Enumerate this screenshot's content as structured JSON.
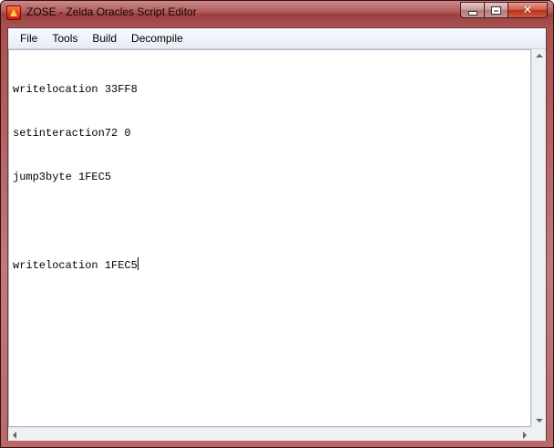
{
  "window": {
    "title": "ZOSE - Zelda Oracles Script Editor",
    "icon": "app-icon",
    "controls": {
      "minimize_icon": "minimize-icon",
      "maximize_icon": "maximize-icon",
      "close_icon": "close-icon",
      "close_glyph": "✕"
    }
  },
  "menubar": {
    "items": [
      "File",
      "Tools",
      "Build",
      "Decompile"
    ]
  },
  "editor": {
    "lines": [
      "writelocation 33FF8",
      "setinteraction72 0",
      "jump3byte 1FEC5",
      "",
      "writelocation 1FEC5"
    ],
    "caret_line": 4
  },
  "scrollbars": {
    "vertical": [
      "scroll-up-arrow-icon",
      "scroll-down-arrow-icon"
    ],
    "horizontal": [
      "scroll-left-arrow-icon",
      "scroll-right-arrow-icon"
    ]
  },
  "colors": {
    "frame": "#b46262",
    "menubar": "#e6ecf5"
  }
}
